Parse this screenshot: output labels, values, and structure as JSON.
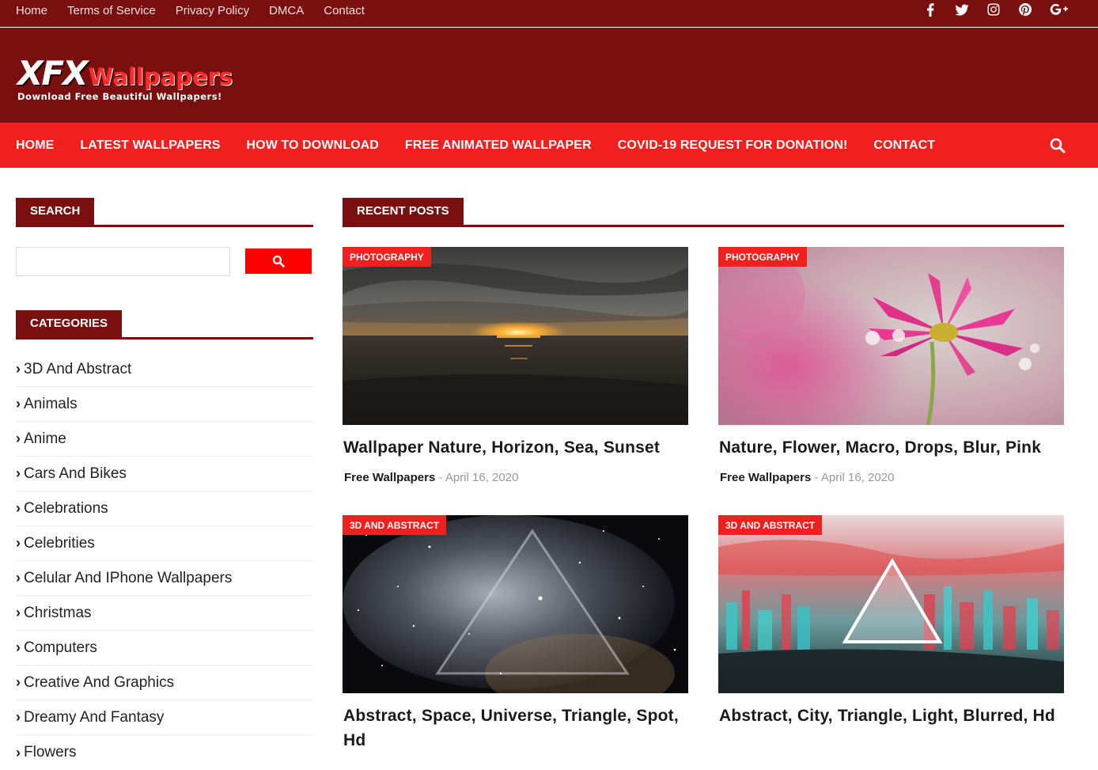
{
  "topnav": [
    "Home",
    "Terms of Service",
    "Privacy Policy",
    "DMCA",
    "Contact"
  ],
  "social_icons": [
    "facebook-icon",
    "twitter-icon",
    "instagram-icon",
    "pinterest-icon",
    "google-plus-icon"
  ],
  "logo": {
    "main": "XFX",
    "accent": "Wallpapers",
    "tagline": "Download Free Beautiful Wallpapers!"
  },
  "mainnav": [
    "HOME",
    "LATEST WALLPAPERS",
    "HOW TO DOWNLOAD",
    "FREE ANIMATED WALLPAPER",
    "COVID-19 REQUEST FOR DONATION!",
    "CONTACT"
  ],
  "sidebar": {
    "search_title": "SEARCH",
    "search_placeholder": "",
    "categories_title": "CATEGORIES",
    "categories": [
      "3D And Abstract",
      "Animals",
      "Anime",
      "Cars And Bikes",
      "Celebrations",
      "Celebrities",
      "Celular And IPhone Wallpapers",
      "Christmas",
      "Computers",
      "Creative And Graphics",
      "Dreamy And Fantasy",
      "Flowers"
    ]
  },
  "main": {
    "recent_title": "RECENT POSTS",
    "posts": [
      {
        "category": "PHOTOGRAPHY",
        "title": "Wallpaper Nature, Horizon, Sea, Sunset",
        "author": "Free Wallpapers",
        "sep": "-",
        "date": "April 16, 2020"
      },
      {
        "category": "PHOTOGRAPHY",
        "title": "Nature, Flower, Macro, Drops, Blur, Pink",
        "author": "Free Wallpapers",
        "sep": "-",
        "date": "April 16, 2020"
      },
      {
        "category": "3D AND ABSTRACT",
        "title": "Abstract, Space, Universe, Triangle, Spot, Hd",
        "author": "",
        "sep": "",
        "date": ""
      },
      {
        "category": "3D AND ABSTRACT",
        "title": "Abstract, City, Triangle, Light, Blurred, Hd",
        "author": "",
        "sep": "",
        "date": ""
      }
    ]
  },
  "colors": {
    "dark_red": "#7a0f0f",
    "bright_red": "#f21f1f",
    "search_red": "#ff0000"
  }
}
